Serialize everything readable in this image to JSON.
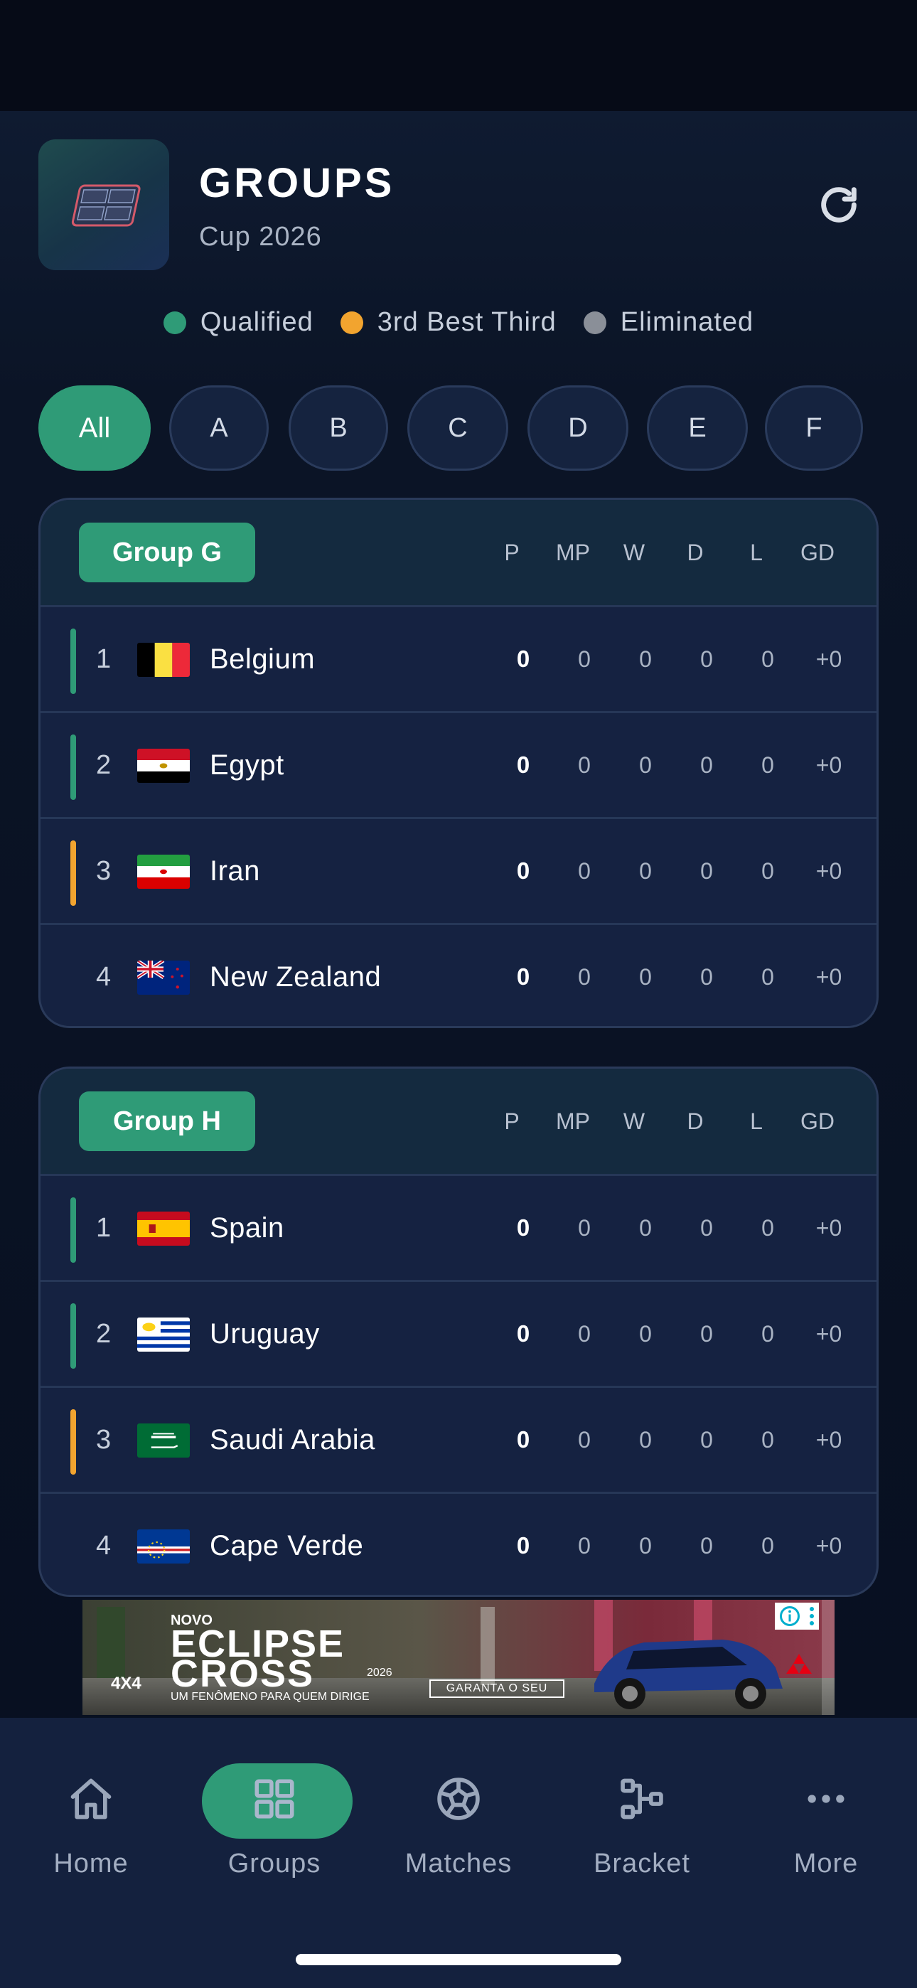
{
  "header": {
    "title": "GROUPS",
    "subtitle": "Cup 2026"
  },
  "legend": [
    {
      "label": "Qualified",
      "color": "#2f9b77"
    },
    {
      "label": "3rd Best Third",
      "color": "#f2a42f"
    },
    {
      "label": "Eliminated",
      "color": "#8a8f98"
    }
  ],
  "filters": [
    "All",
    "A",
    "B",
    "C",
    "D",
    "E",
    "F"
  ],
  "columns": [
    "P",
    "MP",
    "W",
    "D",
    "L",
    "GD"
  ],
  "groups": [
    {
      "name": "Group G",
      "teams": [
        {
          "rank": "1",
          "name": "Belgium",
          "status": "qualified",
          "flag": "belgium",
          "stats": [
            "0",
            "0",
            "0",
            "0",
            "0",
            "+0"
          ]
        },
        {
          "rank": "2",
          "name": "Egypt",
          "status": "qualified",
          "flag": "egypt",
          "stats": [
            "0",
            "0",
            "0",
            "0",
            "0",
            "+0"
          ]
        },
        {
          "rank": "3",
          "name": "Iran",
          "status": "third",
          "flag": "iran",
          "stats": [
            "0",
            "0",
            "0",
            "0",
            "0",
            "+0"
          ]
        },
        {
          "rank": "4",
          "name": "New Zealand",
          "status": "eliminated",
          "flag": "new-zealand",
          "stats": [
            "0",
            "0",
            "0",
            "0",
            "0",
            "+0"
          ]
        }
      ]
    },
    {
      "name": "Group H",
      "teams": [
        {
          "rank": "1",
          "name": "Spain",
          "status": "qualified",
          "flag": "spain",
          "stats": [
            "0",
            "0",
            "0",
            "0",
            "0",
            "+0"
          ]
        },
        {
          "rank": "2",
          "name": "Uruguay",
          "status": "qualified",
          "flag": "uruguay",
          "stats": [
            "0",
            "0",
            "0",
            "0",
            "0",
            "+0"
          ]
        },
        {
          "rank": "3",
          "name": "Saudi Arabia",
          "status": "third",
          "flag": "saudi-arabia",
          "stats": [
            "0",
            "0",
            "0",
            "0",
            "0",
            "+0"
          ]
        },
        {
          "rank": "4",
          "name": "Cape Verde",
          "status": "eliminated",
          "flag": "cape-verde",
          "stats": [
            "0",
            "0",
            "0",
            "0",
            "0",
            "+0"
          ]
        }
      ]
    }
  ],
  "ad": {
    "kicker": "NOVO",
    "line1": "ECLIPSE",
    "line2": "CROSS",
    "year": "2026",
    "tagline": "UM FENÔMENO PARA QUEM DIRIGE",
    "badge": "4X4",
    "cta": "GARANTA O SEU"
  },
  "nav": [
    {
      "label": "Home",
      "icon": "home-icon",
      "active": false
    },
    {
      "label": "Groups",
      "icon": "grid-icon",
      "active": true
    },
    {
      "label": "Matches",
      "icon": "soccer-ball-icon",
      "active": false
    },
    {
      "label": "Bracket",
      "icon": "bracket-icon",
      "active": false
    },
    {
      "label": "More",
      "icon": "more-icon",
      "active": false
    }
  ],
  "colors": {
    "accent": "#2f9b77",
    "third": "#f2a42f",
    "eliminated": "#8a8f98"
  }
}
